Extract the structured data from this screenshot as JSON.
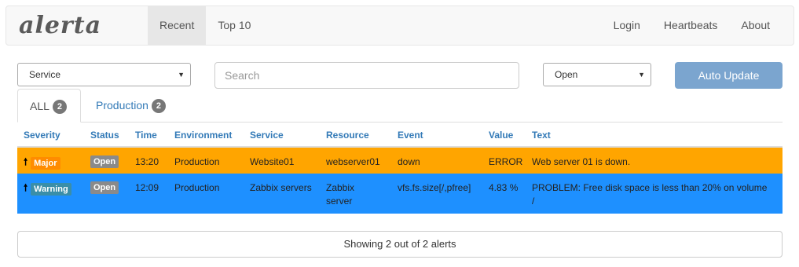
{
  "navbar": {
    "logo": "alerta",
    "left_items": [
      "Recent",
      "Top 10"
    ],
    "right_items": [
      "Login",
      "Heartbeats",
      "About"
    ]
  },
  "filters": {
    "service": "Service",
    "search_placeholder": "Search",
    "status": "Open",
    "auto_update": "Auto Update"
  },
  "tabs": [
    {
      "label": "ALL",
      "count": "2"
    },
    {
      "label": "Production",
      "count": "2"
    }
  ],
  "table": {
    "headers": [
      "Severity",
      "Status",
      "Time",
      "Environment",
      "Service",
      "Resource",
      "Event",
      "Value",
      "Text"
    ],
    "rows": [
      {
        "severity": "Major",
        "status": "Open",
        "time": "13:20",
        "environment": "Production",
        "service": "Website01",
        "resource": "webserver01",
        "event": "down",
        "value": "ERROR",
        "text": "Web server 01 is down.",
        "color": "#ffa500"
      },
      {
        "severity": "Warning",
        "status": "Open",
        "time": "12:09",
        "environment": "Production",
        "service": "Zabbix servers",
        "resource": "Zabbix server",
        "event": "vfs.fs.size[/,pfree]",
        "value": "4.83 %",
        "text": "PROBLEM: Free disk space is less than 20% on volume /",
        "color": "#1e90ff"
      }
    ]
  },
  "footer": "Showing 2 out of 2 alerts"
}
